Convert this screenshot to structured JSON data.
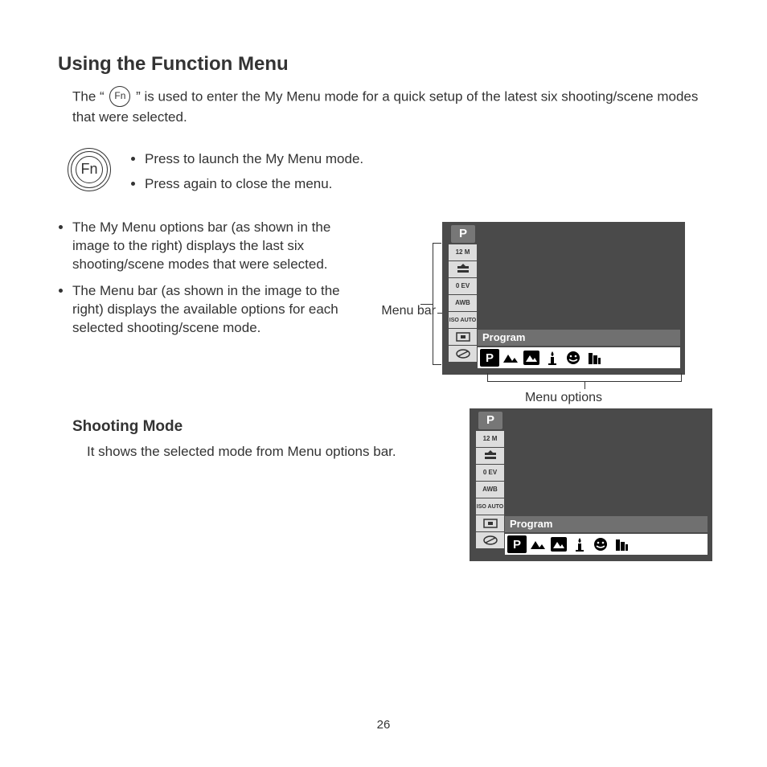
{
  "title": "Using the Function Menu",
  "intro_a": "The “ ",
  "intro_b": " ” is used to enter the My Menu mode for a quick setup of the latest six shooting/scene modes that were selected.",
  "fn_label": "Fn",
  "fn_bullets": [
    "Press to launch the My Menu mode.",
    "Press again to close the menu."
  ],
  "main_bullets": [
    "The My Menu options bar (as shown in the image to the right) displays the last six shooting/scene modes that were selected.",
    "The Menu bar (as shown in the image to the right) displays the available options for each selected shooting/scene mode."
  ],
  "menu_bar_label": "Menu bar",
  "menu_options_label": "Menu options",
  "sidebar": {
    "head": "P",
    "items": [
      "12 M",
      "quality-icon",
      "0 EV",
      "AWB",
      "ISO AUTO",
      "metering-icon",
      "color-icon"
    ]
  },
  "band_label": "Program",
  "option_icons": [
    "program",
    "landscape",
    "night-landscape",
    "candle",
    "smile",
    "building"
  ],
  "shooting_heading": "Shooting Mode",
  "shooting_text": "It shows the selected mode from Menu options bar.",
  "page_number": "26"
}
